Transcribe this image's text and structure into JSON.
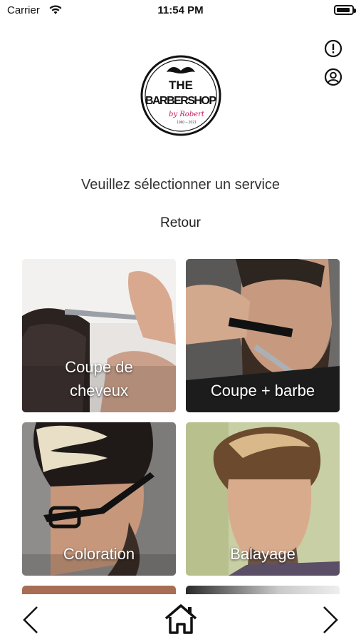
{
  "status_bar": {
    "carrier": "Carrier",
    "time": "11:54 PM",
    "battery_level": 0.9
  },
  "header": {
    "info_icon": "info-circle-icon",
    "profile_icon": "user-circle-icon"
  },
  "logo": {
    "line1": "THE",
    "line2": "BARBERSHOP",
    "signature": "by Robert",
    "years": "1960 – 2021"
  },
  "main": {
    "prompt": "Veuillez sélectionner un service",
    "back_label": "Retour"
  },
  "services": [
    {
      "label_line1": "Coupe de",
      "label_line2": "cheveux"
    },
    {
      "label_line1": "Coupe + barbe",
      "label_line2": ""
    },
    {
      "label_line1": "Coloration",
      "label_line2": ""
    },
    {
      "label_line1": "Balayage",
      "label_line2": ""
    }
  ],
  "bottom_nav": {
    "prev_icon": "chevron-left-icon",
    "home_icon": "home-icon",
    "next_icon": "chevron-right-icon"
  }
}
